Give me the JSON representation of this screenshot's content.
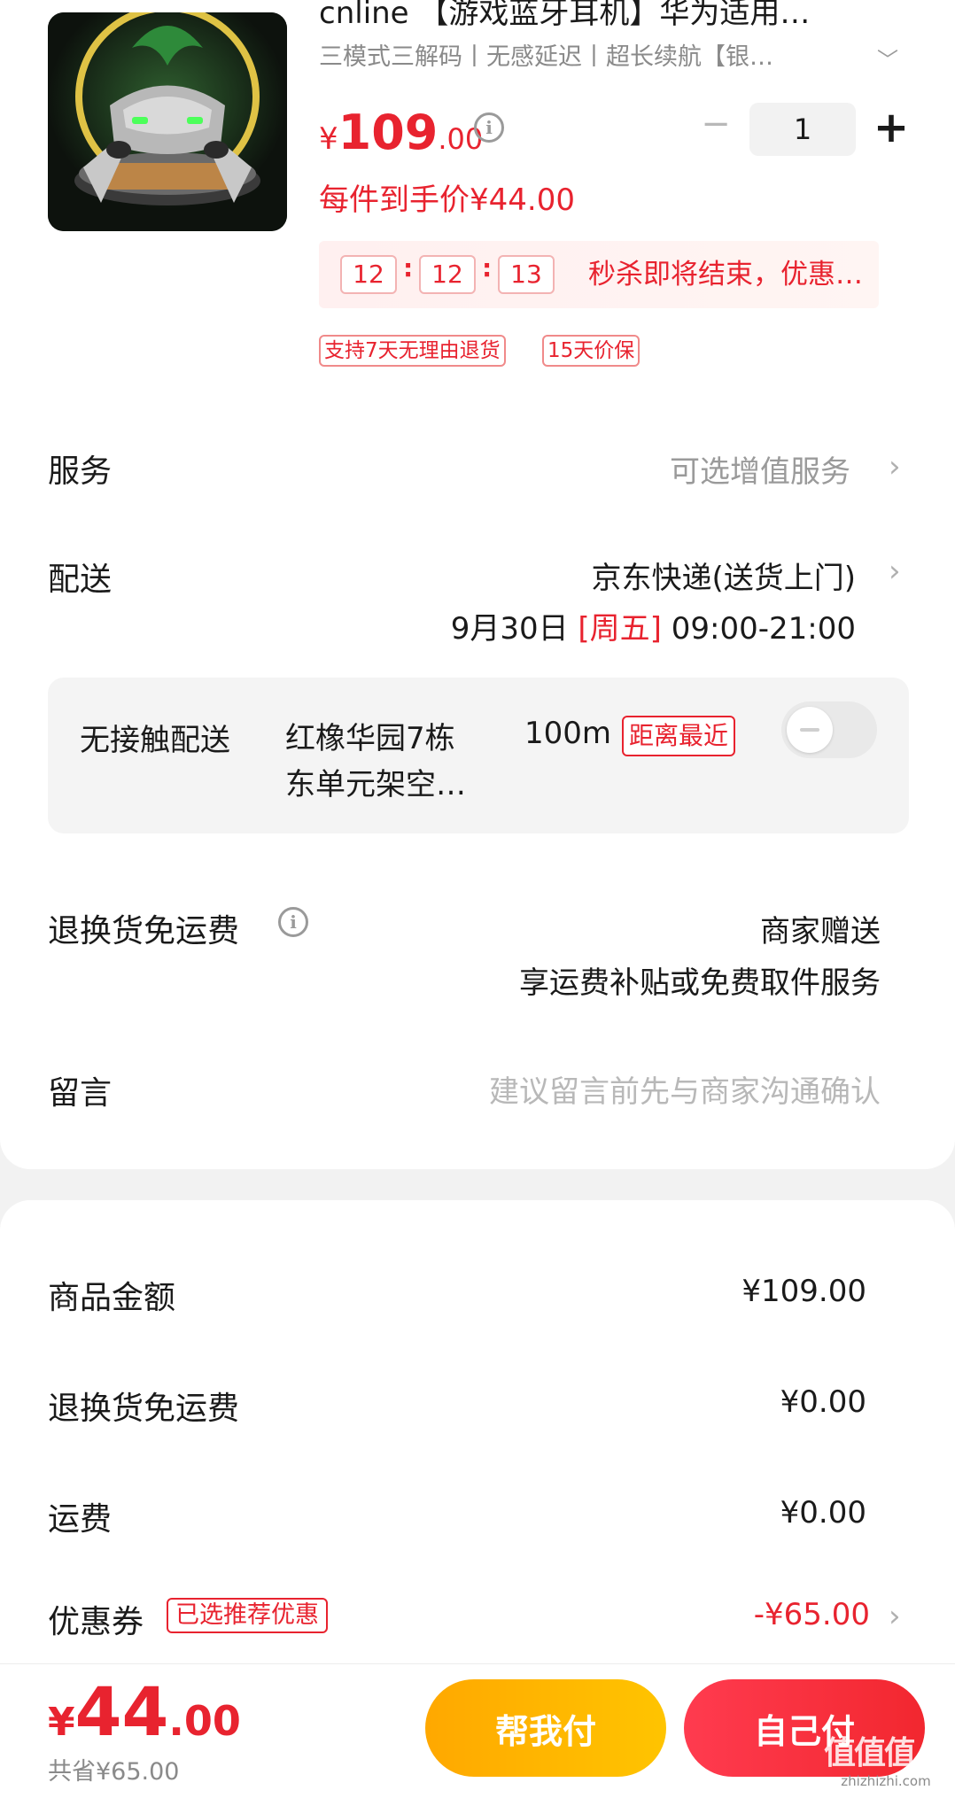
{
  "product": {
    "title": "cnline 【游戏蓝牙耳机】华为适用…",
    "spec": "三模式三解码丨无感延迟丨超长续航【银…",
    "price_currency": "¥",
    "price_int": "109",
    "price_dec": ".00",
    "quantity": "1",
    "per_price": "每件到手价¥44.00",
    "countdown": [
      "12",
      "12",
      "13"
    ],
    "countdown_sep": ":",
    "seckill_text": "秒杀即将结束，优惠…",
    "tags": [
      "支持7天无理由退货",
      "15天价保"
    ]
  },
  "service": {
    "label": "服务",
    "value": "可选增值服务"
  },
  "delivery": {
    "label": "配送",
    "method": "京东快递(送货上门)",
    "date": "9月30日",
    "weekday": "[周五]",
    "time": "09:00-21:00",
    "contactless": {
      "label": "无接触配送",
      "address_line1": "红橡华园7栋",
      "address_line2": "东单元架空…",
      "distance": "100m",
      "distance_tag": "距离最近",
      "enabled": false
    }
  },
  "return_freight": {
    "label": "退换货免运费",
    "value": "商家赠送",
    "desc": "享运费补贴或免费取件服务"
  },
  "message": {
    "label": "留言",
    "placeholder": "建议留言前先与商家沟通确认"
  },
  "summary": {
    "goods": {
      "label": "商品金额",
      "value": "¥109.00"
    },
    "return_freight": {
      "label": "退换货免运费",
      "value": "¥0.00"
    },
    "shipping": {
      "label": "运费",
      "value": "¥0.00"
    },
    "coupon": {
      "label": "优惠券",
      "tag": "已选推荐优惠",
      "value": "-¥65.00"
    }
  },
  "bottom_bar": {
    "total_currency": "¥",
    "total_int": "44",
    "total_dec": ".00",
    "saved": "共省¥65.00",
    "help_pay": "帮我付",
    "self_pay": "自己付"
  },
  "watermark": {
    "text": "值值值",
    "url": "zhizhizhi.com"
  },
  "colors": {
    "accent_red": "#e8232f",
    "help_orange": "#ffb300",
    "background": "#f2f2f2"
  }
}
